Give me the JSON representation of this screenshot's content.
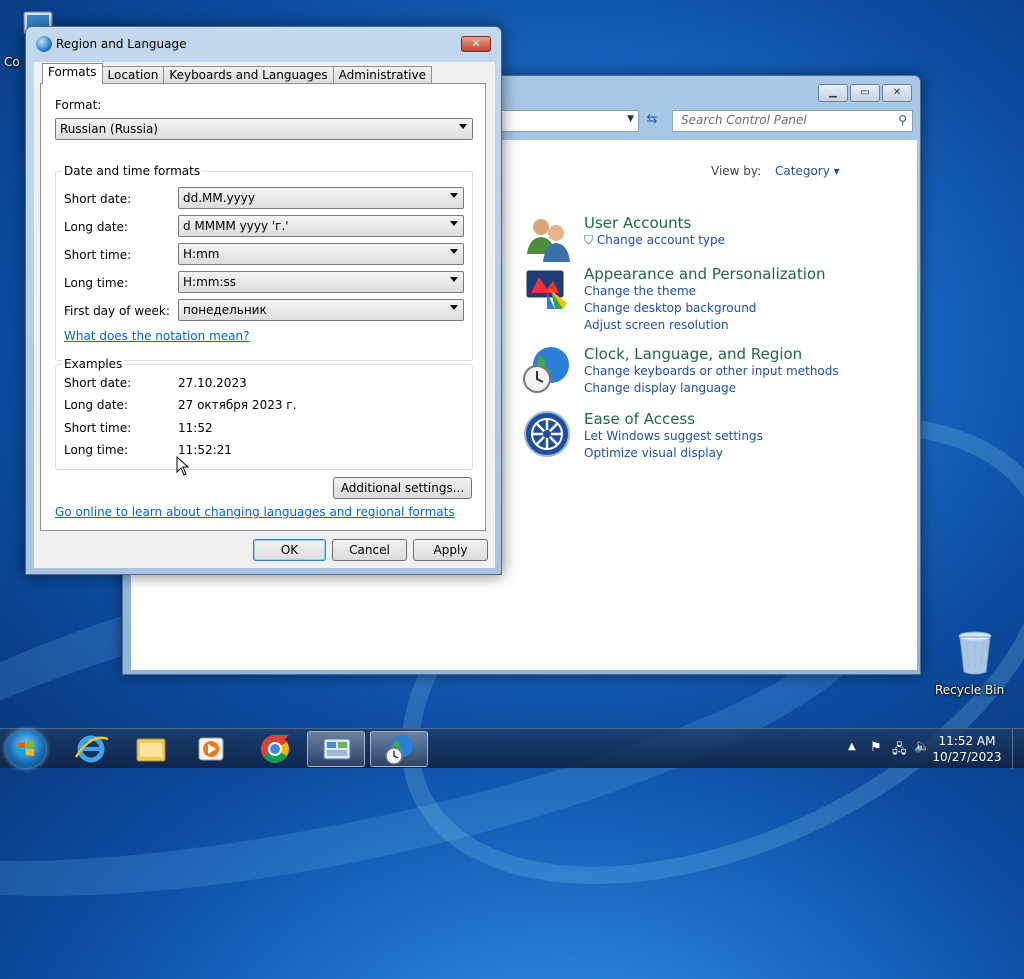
{
  "desktop": {
    "computer_icon_label": "Co",
    "recycle_bin_label": "Recycle Bin"
  },
  "control_panel": {
    "search_placeholder": "Search Control Panel",
    "view_by_label": "View by:",
    "view_by_value": "Category",
    "categories": [
      {
        "title": "User Accounts",
        "links": [
          "Change account type"
        ]
      },
      {
        "title": "Appearance and Personalization",
        "links": [
          "Change the theme",
          "Change desktop background",
          "Adjust screen resolution"
        ]
      },
      {
        "title": "Clock, Language, and Region",
        "links": [
          "Change keyboards or other input methods",
          "Change display language"
        ]
      },
      {
        "title": "Ease of Access",
        "links": [
          "Let Windows suggest settings",
          "Optimize visual display"
        ]
      }
    ]
  },
  "dialog": {
    "title": "Region and Language",
    "tabs": [
      "Formats",
      "Location",
      "Keyboards and Languages",
      "Administrative"
    ],
    "format_label": "Format:",
    "format_value": "Russian (Russia)",
    "dt_group_label": "Date and time formats",
    "fields": [
      {
        "label": "Short date:",
        "value": "dd.MM.yyyy"
      },
      {
        "label": "Long date:",
        "value": "d MMMM yyyy 'г.'"
      },
      {
        "label": "Short time:",
        "value": "H:mm"
      },
      {
        "label": "Long time:",
        "value": "H:mm:ss"
      },
      {
        "label": "First day of week:",
        "value": "понедельник"
      }
    ],
    "notation_link": "What does the notation mean?",
    "examples_label": "Examples",
    "examples": [
      {
        "label": "Short date:",
        "value": "27.10.2023"
      },
      {
        "label": "Long date:",
        "value": "27 октября 2023 г."
      },
      {
        "label": "Short time:",
        "value": "11:52"
      },
      {
        "label": "Long time:",
        "value": "11:52:21"
      }
    ],
    "additional_button": "Additional settings...",
    "online_link": "Go online to learn about changing languages and regional formats",
    "ok": "OK",
    "cancel": "Cancel",
    "apply": "Apply"
  },
  "taskbar": {
    "time": "11:52 AM",
    "date": "10/27/2023"
  }
}
